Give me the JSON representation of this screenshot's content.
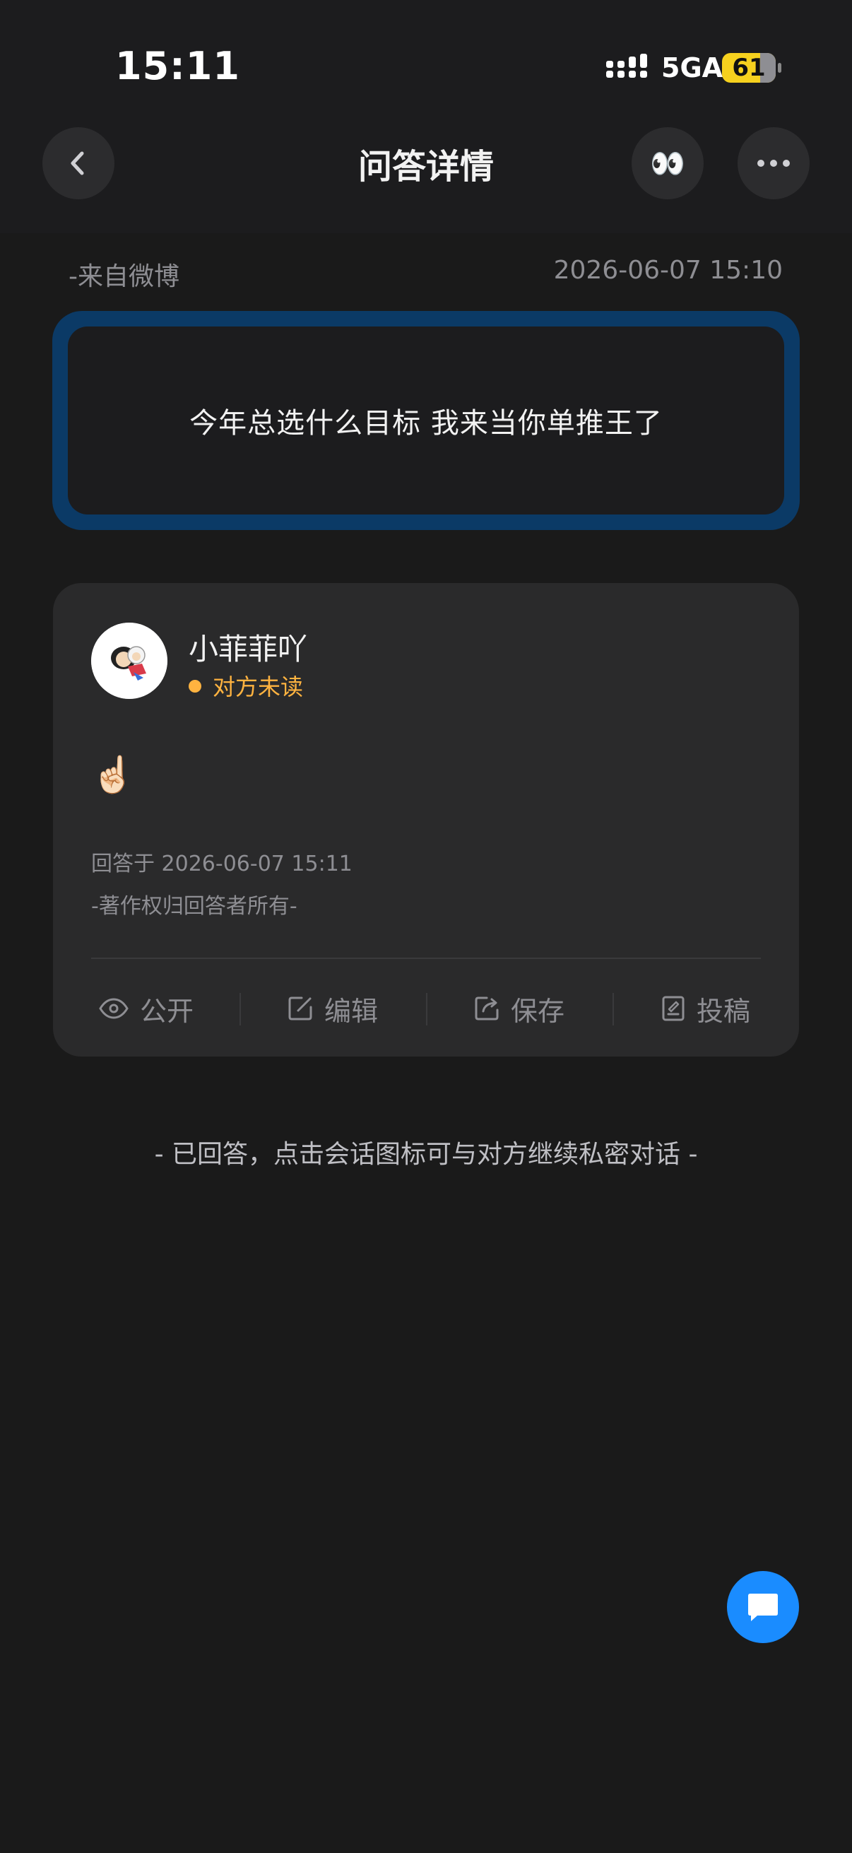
{
  "status_bar": {
    "time": "15:11",
    "network": "5GA",
    "battery": "61"
  },
  "header": {
    "title": "问答详情",
    "back_icon": "chevron-left-icon",
    "eyes_emoji": "👀",
    "more_icon": "ellipsis-icon"
  },
  "question": {
    "source": "-来自微博",
    "time": "2026-06-07 15:10",
    "text": "今年总选什么目标 我来当你单推王了",
    "border_color": "#0b3a66"
  },
  "answer": {
    "username": "小菲菲吖",
    "read_status": "对方未读",
    "content": "☝🏻",
    "answered_at": "回答于 2026-06-07 15:11",
    "copyright": "-著作权归回答者所有-",
    "actions": [
      {
        "label": "公开",
        "icon": "eye-icon"
      },
      {
        "label": "编辑",
        "icon": "edit-icon"
      },
      {
        "label": "保存",
        "icon": "share-icon"
      },
      {
        "label": "投稿",
        "icon": "document-icon"
      }
    ]
  },
  "footer_note": "- 已回答，点击会话图标可与对方继续私密对话 -",
  "fab": {
    "icon": "chat-bubble-icon",
    "color": "#1a8cff"
  },
  "colors": {
    "background": "#1a1a1a",
    "card": "#2a2a2b",
    "accent_unread": "#ffb340",
    "battery": "#f6d11e"
  }
}
